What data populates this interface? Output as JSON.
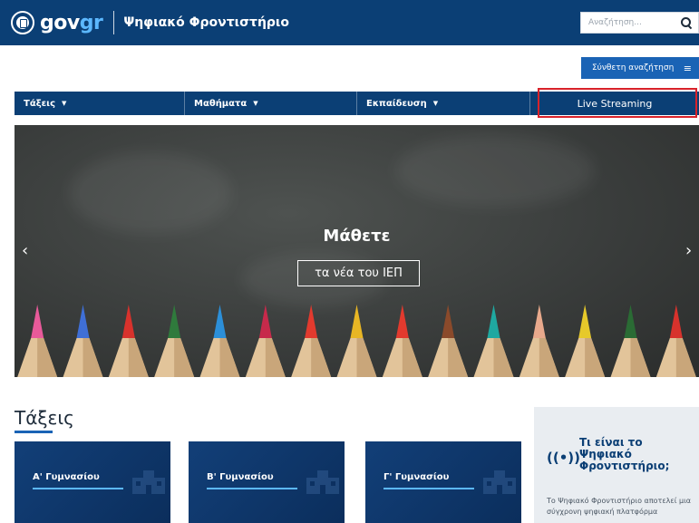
{
  "header": {
    "logo_gov": "gov",
    "logo_gr": "gr",
    "site_title": "Ψηφιακό Φροντιστήριο",
    "search_placeholder": "Αναζήτηση..."
  },
  "advanced_search": {
    "label": "Σύνθετη αναζήτηση"
  },
  "nav": {
    "items": [
      {
        "label": "Τάξεις"
      },
      {
        "label": "Μαθήματα"
      },
      {
        "label": "Εκπαίδευση"
      },
      {
        "label": "Live Streaming"
      }
    ]
  },
  "hero": {
    "title": "Μάθετε",
    "button_label": "τα νέα του ΙΕΠ",
    "prev_arrow": "‹",
    "next_arrow": "›"
  },
  "classes": {
    "title": "Τάξεις",
    "cards": [
      {
        "label": "Α' Γυμνασίου"
      },
      {
        "label": "Β' Γυμνασίου"
      },
      {
        "label": "Γ' Γυμνασίου"
      }
    ]
  },
  "info": {
    "icon": "broadcast-icon",
    "icon_glyph": "((•))",
    "title": "Τι είναι το Ψηφιακό Φροντιστήριο;",
    "description": "Το Ψηφιακό Φροντιστήριο αποτελεί μια σύγχρονη ψηφιακή πλατφόρμα"
  },
  "colors": {
    "primary": "#0b3f75",
    "accent": "#1a63b5",
    "highlight": "#d9222a"
  },
  "pencil_colors": [
    "#e85a9a",
    "#3f6fd6",
    "#d8322c",
    "#2f7a3c",
    "#2c8fd8",
    "#c72a4b",
    "#e23a2e",
    "#e8b624",
    "#e23a2e",
    "#8b4a2b",
    "#1fa8a0",
    "#e8a98c",
    "#e6c92a",
    "#2a6b34",
    "#d8322c"
  ]
}
